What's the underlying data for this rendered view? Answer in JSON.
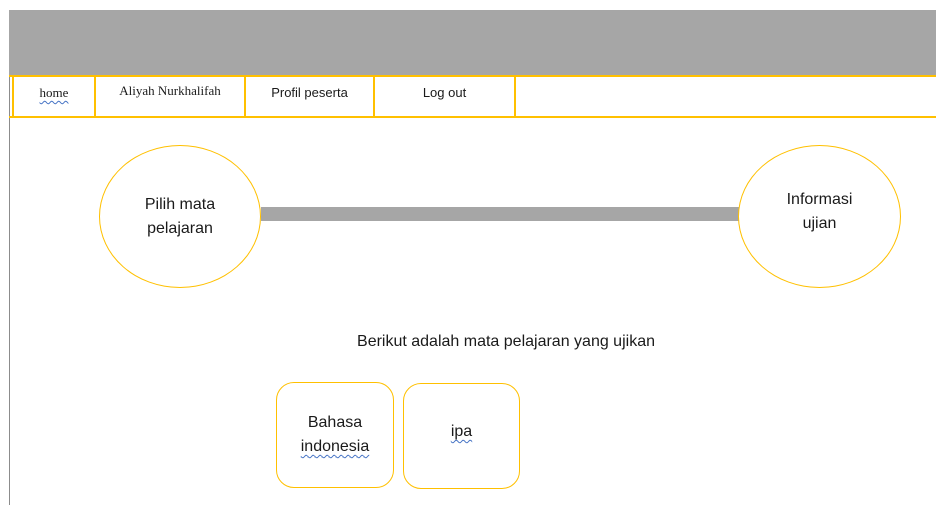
{
  "nav": {
    "home": "home",
    "username": "Aliyah Nurkhalifah",
    "profile": "Profil peserta",
    "logout": "Log out"
  },
  "steps": {
    "left_line1": "Pilih mata",
    "left_line2": "pelajaran",
    "right_line1": "Informasi",
    "right_line2": "ujian"
  },
  "subtitle": "Berikut adalah mata pelajaran yang ujikan",
  "subjects": [
    {
      "line1": "Bahasa",
      "line2": "indonesia"
    },
    {
      "line1": "ipa"
    }
  ],
  "colors": {
    "accent": "#ffc000",
    "banner": "#a6a6a6"
  }
}
